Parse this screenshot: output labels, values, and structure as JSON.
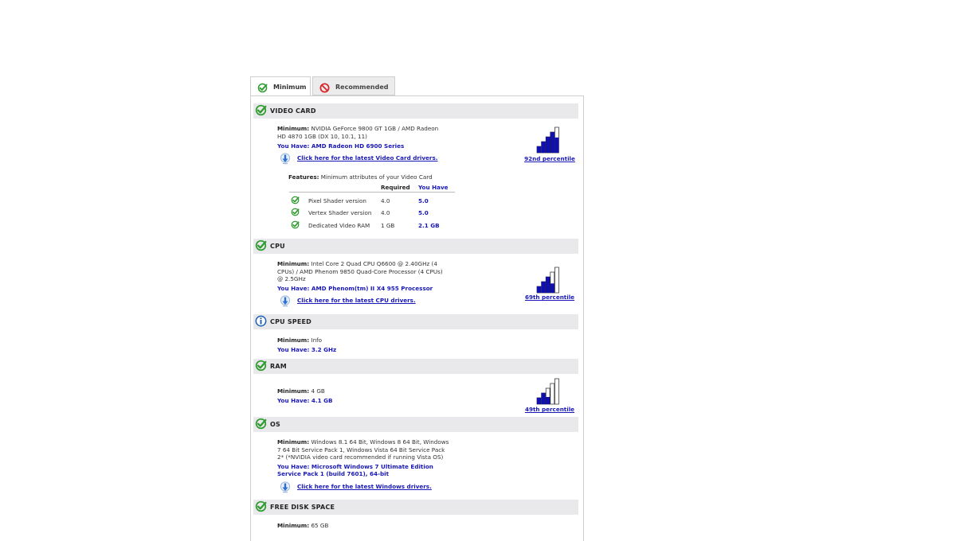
{
  "tabs": [
    {
      "label": "Minimum",
      "status": "pass"
    },
    {
      "label": "Recommended",
      "status": "fail"
    }
  ],
  "colors": {
    "pass": "#2e9b2e",
    "fail": "#d8262a",
    "info": "#1a5fb4",
    "have": "#1818b8",
    "bar_fill": "#1010b0"
  },
  "sections": {
    "video_card": {
      "title": "VIDEO CARD",
      "status": "pass",
      "minimum_label": "Minimum:",
      "minimum_line1": "NVIDIA GeForce 9800 GT 1GB / AMD Radeon",
      "minimum_line2": "HD 4870 1GB (DX 10, 10.1, 11)",
      "you_have": "You Have: AMD Radeon HD 6900 Series",
      "driver_link": "Click here for the latest Video Card drivers.",
      "percentile": {
        "label": "92nd percentile",
        "value": 92
      },
      "features": {
        "label": "Features:",
        "description": "Minimum attributes of your Video Card",
        "col_required": "Required",
        "col_you_have": "You Have",
        "rows": [
          {
            "name": "Pixel Shader version",
            "required": "4.0",
            "you_have": "5.0"
          },
          {
            "name": "Vertex Shader version",
            "required": "4.0",
            "you_have": "5.0"
          },
          {
            "name": "Dedicated Video RAM",
            "required": "1 GB",
            "you_have": "2.1 GB"
          }
        ]
      }
    },
    "cpu": {
      "title": "CPU",
      "status": "pass",
      "minimum_label": "Minimum:",
      "minimum_line1": "Intel Core 2 Quad CPU Q6600 @ 2.40GHz (4",
      "minimum_line2": "CPUs) / AMD Phenom 9850 Quad-Core Processor (4 CPUs)",
      "minimum_line3": "@ 2.5GHz",
      "you_have": "You Have: AMD Phenom(tm) II X4 955 Processor",
      "driver_link": "Click here for the latest CPU drivers.",
      "percentile": {
        "label": "69th percentile",
        "value": 69
      }
    },
    "cpu_speed": {
      "title": "CPU SPEED",
      "status": "info",
      "minimum_label": "Minimum:",
      "minimum_value": "Info",
      "you_have": "You Have: 3.2 GHz"
    },
    "ram": {
      "title": "RAM",
      "status": "pass",
      "minimum_label": "Minimum:",
      "minimum_value": "4 GB",
      "you_have": "You Have: 4.1 GB",
      "percentile": {
        "label": "49th percentile",
        "value": 49
      }
    },
    "os": {
      "title": "OS",
      "status": "pass",
      "minimum_label": "Minimum:",
      "minimum_line1": "Windows 8.1 64 Bit, Windows 8 64 Bit, Windows",
      "minimum_line2": "7 64 Bit Service Pack 1, Windows Vista 64 Bit Service Pack",
      "minimum_line3": "2* (*NVIDIA video card recommended if running Vista OS)",
      "you_have_line1": "You Have: Microsoft Windows 7 Ultimate Edition",
      "you_have_line2": "Service Pack 1 (build 7601), 64-bit",
      "driver_link": "Click here for the latest Windows drivers."
    },
    "disk": {
      "title": "FREE DISK SPACE",
      "status": "pass",
      "minimum_label": "Minimum:",
      "minimum_value": "65 GB"
    }
  }
}
